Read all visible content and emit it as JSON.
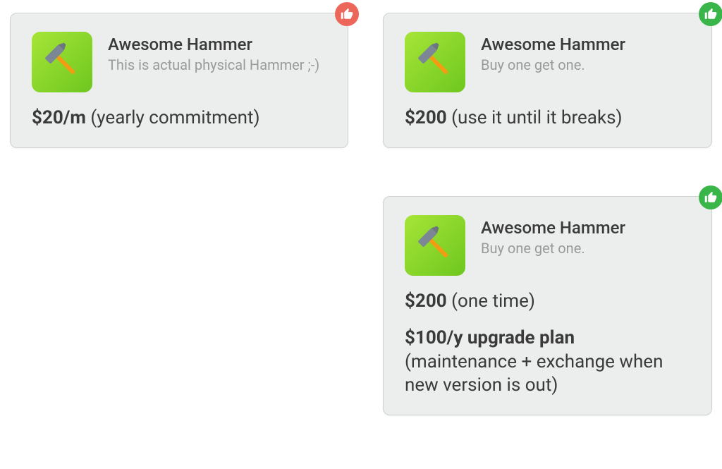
{
  "cards": [
    {
      "title": "Awesome Hammer",
      "subtitle": "This is actual physical Hammer  ;-)",
      "price_bold": "$20/m",
      "price_rest": " (yearly commitment)",
      "extra_bold": "",
      "extra_rest": "",
      "badge": "bad"
    },
    {
      "title": "Awesome Hammer",
      "subtitle": "Buy one get one.",
      "price_bold": "$200",
      "price_rest": " (use it until it breaks)",
      "extra_bold": "",
      "extra_rest": "",
      "badge": "good"
    },
    {
      "title": "Awesome Hammer",
      "subtitle": "Buy one get one.",
      "price_bold": "$200",
      "price_rest": " (one time)",
      "extra_bold": "$100/y upgrade plan",
      "extra_rest": " (maintenance + exchange when new version is out)",
      "badge": "good"
    }
  ],
  "colors": {
    "card_bg": "#eceded",
    "card_border": "#d0d1d2",
    "icon_grad_start": "#a7e538",
    "icon_grad_end": "#6ec71f",
    "badge_bad": "#ec6759",
    "badge_good": "#3ab54a"
  }
}
